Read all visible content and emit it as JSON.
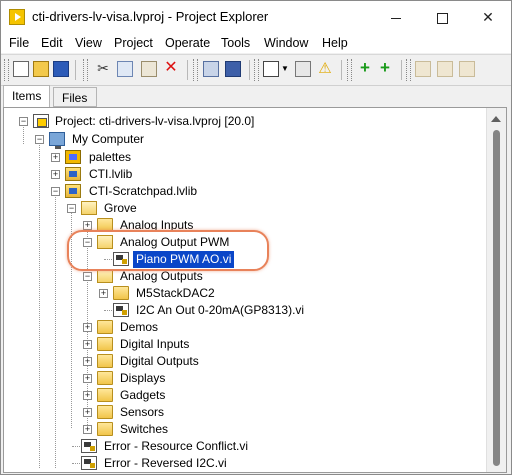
{
  "window": {
    "title": "cti-drivers-lv-visa.lvproj - Project Explorer",
    "controls": {
      "minimize": "—",
      "maximize": "□",
      "close": "✕"
    }
  },
  "menu": [
    "File",
    "Edit",
    "View",
    "Project",
    "Operate",
    "Tools",
    "Window",
    "Help"
  ],
  "toolbar": {
    "buttons": [
      "new-file-icon",
      "open-folder-icon",
      "save-all-icon",
      "cut-icon",
      "copy-icon",
      "paste-icon",
      "delete-icon",
      "build-icon",
      "save-icon",
      "view-icon",
      "dropdown-icon",
      "filter-icon",
      "warning-icon",
      "add-green-icon",
      "add-green-2-icon",
      "group-icon",
      "package-icon",
      "object-icon"
    ]
  },
  "tabs": [
    "Items",
    "Files"
  ],
  "tree": {
    "project": "Project: cti-drivers-lv-visa.lvproj [20.0]",
    "my_computer": "My Computer",
    "palettes": "palettes",
    "cti_lib": "CTI.lvlib",
    "scratchpad_lib": "CTI-Scratchpad.lvlib",
    "grove": "Grove",
    "analog_inputs": "Analog Inputs",
    "analog_output_pwm": "Analog Output PWM",
    "piano_vi": "Piano PWM AO.vi",
    "analog_outputs": "Analog Outputs",
    "m5stack": "M5StackDAC2",
    "i2c_vi": "I2C An Out 0-20mA(GP8313).vi",
    "demos": "Demos",
    "digital_inputs": "Digital Inputs",
    "digital_outputs": "Digital Outputs",
    "displays": "Displays",
    "gadgets": "Gadgets",
    "sensors": "Sensors",
    "switches": "Switches",
    "error_conflict": "Error - Resource Conflict.vi",
    "error_reversed": "Error - Reversed I2C.vi"
  },
  "colors": {
    "selection": "#0a46c8",
    "annotation": "#e8825a"
  }
}
